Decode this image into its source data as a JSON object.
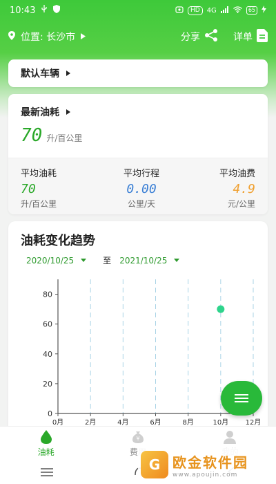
{
  "status_bar": {
    "time": "10:43",
    "hd": "HD",
    "network": "4G",
    "battery": "65"
  },
  "header": {
    "location_label": "位置: 长沙市",
    "share_label": "分享",
    "detail_label": "详单"
  },
  "vehicle_card": {
    "label": "默认车辆"
  },
  "fuel_card": {
    "title": "最新油耗",
    "latest_value": "70",
    "latest_unit": "升/百公里",
    "stats": [
      {
        "label": "平均油耗",
        "value": "70",
        "unit": "升/百公里",
        "color": "#2aa829"
      },
      {
        "label": "平均行程",
        "value": "0.00",
        "unit": "公里/天",
        "color": "#3a7fd5"
      },
      {
        "label": "平均油费",
        "value": "4.9",
        "unit": "元/公里",
        "color": "#f0a030"
      }
    ]
  },
  "trend_card": {
    "title": "油耗变化趋势",
    "start_date": "2020/10/25",
    "to_label": "至",
    "end_date": "2021/10/25"
  },
  "chart_data": {
    "type": "scatter",
    "x_tick_labels": [
      "0月",
      "2月",
      "4月",
      "6月",
      "8月",
      "10月",
      "12月"
    ],
    "y_tick_labels": [
      "0",
      "20",
      "40",
      "60",
      "80"
    ],
    "xlim": [
      0,
      12
    ],
    "ylim": [
      0,
      90
    ],
    "grid": "vertical-dashed",
    "points": [
      {
        "x": 10,
        "y": 70
      }
    ],
    "point_color": "#2ed48c"
  },
  "tabs": [
    {
      "label": "油耗",
      "icon": "fuel-drop-icon",
      "active": true
    },
    {
      "label": "费用",
      "icon": "money-bag-icon",
      "active": false
    },
    {
      "label": "我的",
      "icon": "user-icon",
      "active": false
    }
  ],
  "watermark": {
    "logo_char": "G",
    "name": "欧金软件园",
    "url": "www.apoujin.com"
  },
  "colors": {
    "brand_green": "#2aa829",
    "header_green": "#3ec93a",
    "fab_green": "#29b93a"
  }
}
